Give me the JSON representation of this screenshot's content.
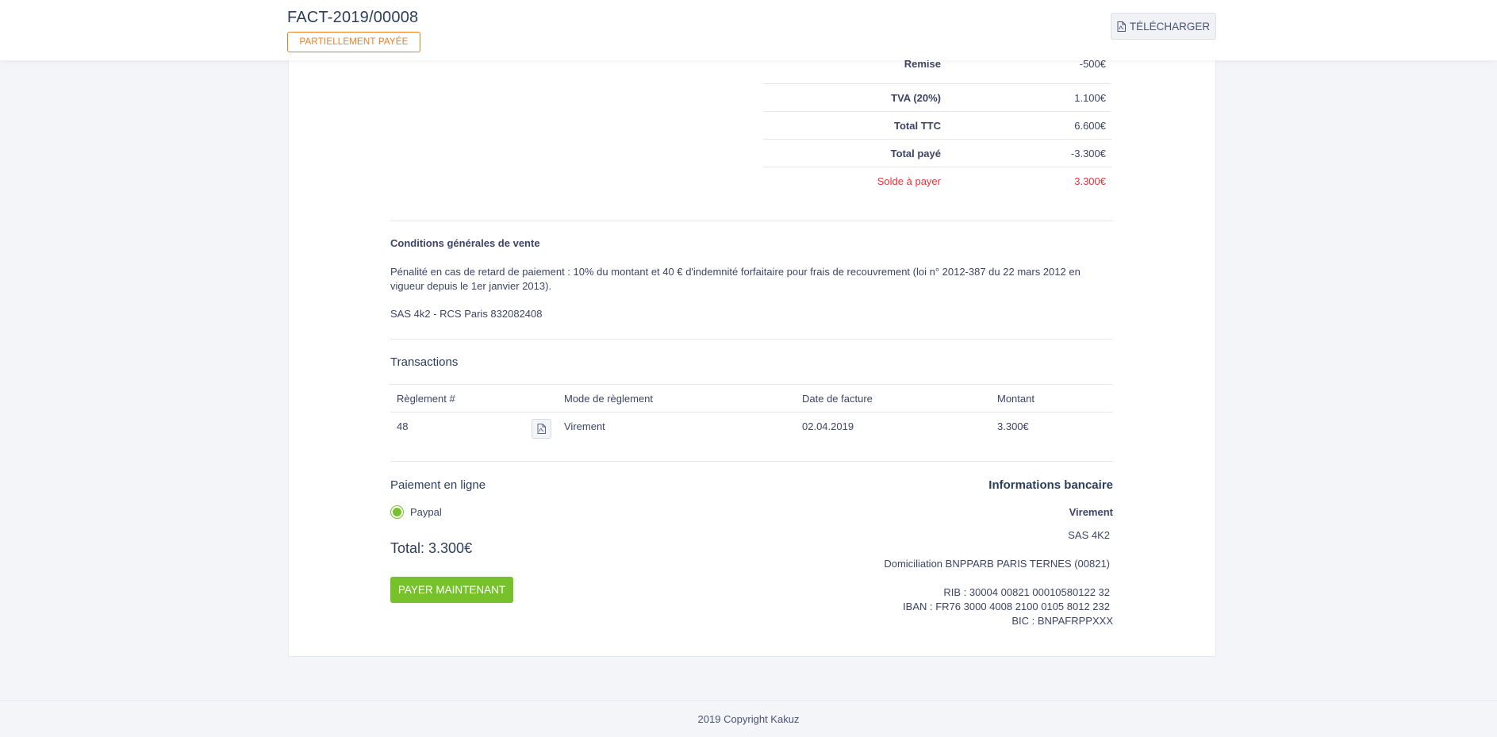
{
  "header": {
    "invoice_number": "FACT-2019/00008",
    "status": "PARTIELLEMENT PAYÉE",
    "download_label": "TÉLÉCHARGER"
  },
  "totals": [
    {
      "label": "Remise",
      "value": "-500€"
    },
    {
      "label": "TVA (20%)",
      "value": "1.100€"
    },
    {
      "label": "Total TTC",
      "value": "6.600€"
    },
    {
      "label": "Total payé",
      "value": "-3.300€"
    },
    {
      "label": "Solde à payer",
      "value": "3.300€"
    }
  ],
  "conditions": {
    "title": "Conditions générales de vente",
    "text": "Pénalité en cas de retard de paiement : 10% du montant et 40 € d'indemnité forfaitaire pour frais de recouvrement (loi n° 2012-387 du 22 mars 2012 en vigueur depuis le 1er janvier 2013).",
    "company": "SAS 4k2 - RCS Paris 832082408"
  },
  "transactions": {
    "title": "Transactions",
    "headers": [
      "Règlement #",
      "Mode de règlement",
      "Date de facture",
      "Montant"
    ],
    "rows": [
      {
        "id": "48",
        "mode": "Virement",
        "date": "02.04.2019",
        "amount": "3.300€"
      }
    ]
  },
  "online_payment": {
    "title": "Paiement en ligne",
    "method": "Paypal",
    "total": "Total: 3.300€",
    "pay_label": "PAYER MAINTENANT"
  },
  "bank_info": {
    "title": "Informations bancaire",
    "method": "Virement",
    "holder": "SAS 4K2",
    "domiciliation": "Domiciliation BNPPARB PARIS TERNES (00821)",
    "rib": "RIB : 30004 00821 00010580122 32",
    "iban": "IBAN : FR76 3000 4008 2100 0105 8012 232",
    "bic": "BIC : BNPAFRPPXXX"
  },
  "footer": {
    "copyright": "2019 Copyright Kakuz"
  },
  "colors": {
    "accent_orange": "#f47b20",
    "danger_red": "#e8323c",
    "success_green": "#77c22a"
  },
  "icons": {
    "download": "pdf-file-icon",
    "receipt": "pdf-file-icon",
    "payment_radio": "radio-selected-icon"
  }
}
